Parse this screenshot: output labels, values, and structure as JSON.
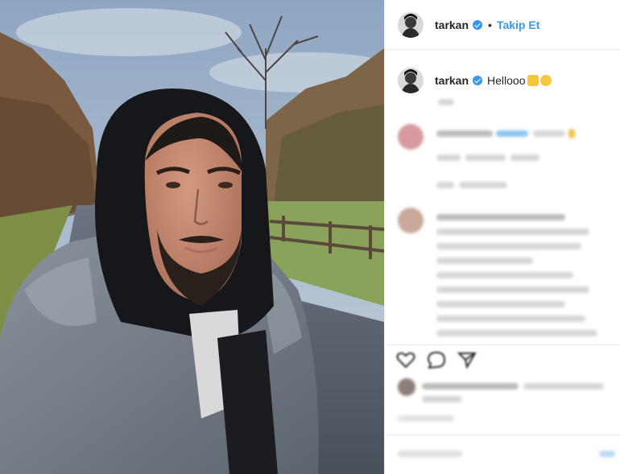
{
  "post": {
    "username": "tarkan",
    "separator": "•",
    "follow_label": "Takip Et",
    "caption_text": "Hellooo"
  },
  "icons": {
    "verified": "verified-badge-icon",
    "like": "heart-icon",
    "comment": "comment-icon",
    "share": "share-icon"
  },
  "colors": {
    "link": "#3897f0",
    "text": "#262626"
  }
}
